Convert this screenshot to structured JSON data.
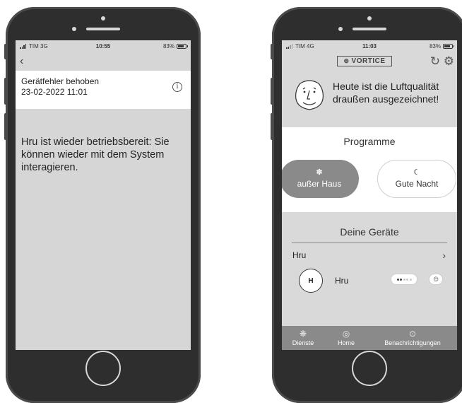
{
  "left": {
    "status": {
      "carrier": "TIM  3G",
      "time": "10:55",
      "battery": "83%"
    },
    "notification": {
      "title": "Gerätfehler behoben",
      "date": "23-02-2022 11:01",
      "body": "Hru ist wieder betriebsbereit: Sie können wieder mit dem System interagieren."
    }
  },
  "right": {
    "status": {
      "carrier": "TIM  4G",
      "time": "11:03",
      "battery": "83%"
    },
    "header": {
      "logo": "VORTICE"
    },
    "banner": {
      "line1": "Heute ist die Luftqualität",
      "line2": "draußen ausgezeichnet!"
    },
    "programs": {
      "title": "Programme",
      "away_label": "außer Haus",
      "night_label": "Gute Nacht"
    },
    "devices": {
      "title": "Deine Geräte",
      "group_label": "Hru",
      "device_initial": "H",
      "device_name": "Hru",
      "speed_level": 2,
      "speed_max": 5
    },
    "tabs": {
      "services": "Dienste",
      "home": "Home",
      "notifications": "Benachrichtigungen"
    }
  }
}
